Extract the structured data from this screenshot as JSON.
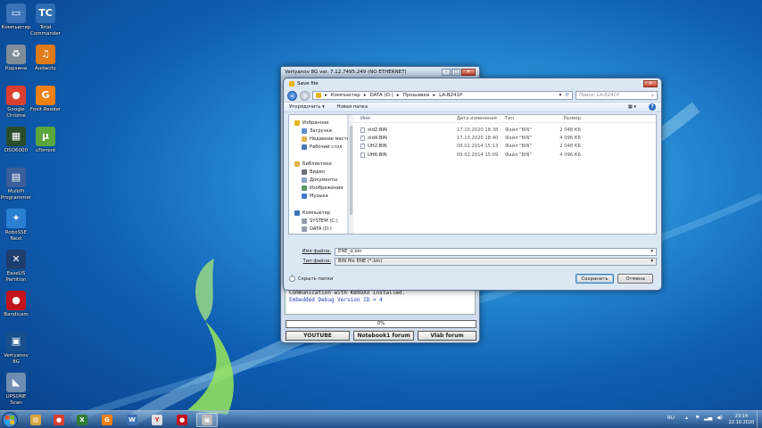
{
  "desktop": {
    "icons": [
      {
        "label": "Компьютер",
        "glyph": "▭",
        "color": "#3a73b8"
      },
      {
        "label": "Total Commander",
        "glyph": "TC",
        "color": "#2e6db3"
      },
      {
        "label": "Корзина",
        "glyph": "♻",
        "color": "#7f8c99"
      },
      {
        "label": "Audacity",
        "glyph": "♫",
        "color": "#e07b1a"
      },
      {
        "label": "Google Chrome",
        "glyph": "●",
        "color": "#d9402f"
      },
      {
        "label": "Foxit Reader",
        "glyph": "G",
        "color": "#f07f14"
      },
      {
        "label": "DSO6000",
        "glyph": "▦",
        "color": "#2a4c2a"
      },
      {
        "label": "uTorrent",
        "glyph": "µ",
        "color": "#5aa83c"
      },
      {
        "label": "MultiPi Programmer",
        "glyph": "▤",
        "color": "#3b5f9b"
      },
      {
        "label": "RoboSSE Next",
        "glyph": "✦",
        "color": "#2b7fd3"
      },
      {
        "label": "EaseUS Partition",
        "glyph": "✕",
        "color": "#1e3e6f"
      },
      {
        "label": "Bandicam",
        "glyph": "●",
        "color": "#c2141c"
      },
      {
        "label": "Vertyanov 8G",
        "glyph": "▣",
        "color": "#18508c"
      },
      {
        "label": "UPSONE Scan",
        "glyph": "◣",
        "color": "#6f8db0"
      }
    ]
  },
  "vert_window": {
    "title": "Vertyanov 8G ver. 7.12.7495.249 (NO ETHERNET)",
    "console_lines": [
      "Communication with KB9OXX installed.",
      "Embedded Debug Version ID = 4"
    ],
    "console_line_colors": [
      "#1e1e1e",
      "#1f3fbf"
    ],
    "progress": "0%",
    "progress_value": 0,
    "buttons": [
      "YOUTUBE",
      "Notebook1 forum",
      "Vlab forum"
    ]
  },
  "save_dialog": {
    "title": "Save file",
    "breadcrumb": [
      "Компьютер",
      "DATA (D:)",
      "Прошивки",
      "LA-B241P"
    ],
    "search_placeholder": "Поиск: LA-B241P",
    "toolbar": {
      "organize": "Упорядочить ▾",
      "new_folder": "Новая папка"
    },
    "nav": [
      {
        "label": "Избранное",
        "level": 0,
        "color": "#e8b41e"
      },
      {
        "label": "Загрузки",
        "level": 1,
        "color": "#5b8fd1"
      },
      {
        "label": "Недавние места",
        "level": 1,
        "color": "#e0b84e"
      },
      {
        "label": "Рабочий стол",
        "level": 1,
        "color": "#4a77b5"
      },
      {
        "label": "",
        "level": 0,
        "color": ""
      },
      {
        "label": "Библиотеки",
        "level": 0,
        "color": "#e3b34a"
      },
      {
        "label": "Видео",
        "level": 1,
        "color": "#6a6f7a"
      },
      {
        "label": "Документы",
        "level": 1,
        "color": "#8aa3c4"
      },
      {
        "label": "Изображения",
        "level": 1,
        "color": "#5a9a64"
      },
      {
        "label": "Музыка",
        "level": 1,
        "color": "#3f7bd0"
      },
      {
        "label": "",
        "level": 0,
        "color": ""
      },
      {
        "label": "Компьютер",
        "level": 0,
        "color": "#3a73b8"
      },
      {
        "label": "SYSTEM (C:)",
        "level": 1,
        "color": "#909aa6"
      },
      {
        "label": "DATA (D:)",
        "level": 1,
        "color": "#909aa6"
      }
    ],
    "columns": [
      "Имя",
      "Дата изменения",
      "Тип",
      "Размер"
    ],
    "files": [
      {
        "name": "old2.BIN",
        "date": "17.10.2020 18:38",
        "type": "Файл \"BIN\"",
        "size": "2 048 КБ"
      },
      {
        "name": "old4.BIN",
        "date": "17.10.2020 18:40",
        "type": "Файл \"BIN\"",
        "size": "4 096 КБ"
      },
      {
        "name": "UH2.BIN",
        "date": "09.02.2014 15:13",
        "type": "Файл \"BIN\"",
        "size": "2 048 КБ"
      },
      {
        "name": "UH6.BIN",
        "date": "09.02.2014 15:09",
        "type": "Файл \"BIN\"",
        "size": "4 096 КБ"
      }
    ],
    "filename_label": "Имя файла:",
    "filename_value": "ENE_d.bin",
    "filetype_label": "Тип файла:",
    "filetype_value": "BIN file ENE (*.bin)",
    "hide_folders": "Скрыть папки",
    "save": "Сохранить",
    "cancel": "Отмена"
  },
  "taskbar": {
    "apps": [
      {
        "glyph": "▤",
        "color": "#d9a63b"
      },
      {
        "glyph": "●",
        "color": "#d9402f"
      },
      {
        "glyph": "X",
        "color": "#2e7d32"
      },
      {
        "glyph": "G",
        "color": "#f07f14"
      },
      {
        "glyph": "W",
        "color": "#3b6fb5"
      },
      {
        "glyph": "Y",
        "color": "#e0e0e0"
      },
      {
        "glyph": "●",
        "color": "#c2141c"
      },
      {
        "glyph": "▣",
        "color": "#bbbbbb"
      }
    ],
    "lang": "RU",
    "time": "23:14",
    "date": "22.10.2020"
  }
}
